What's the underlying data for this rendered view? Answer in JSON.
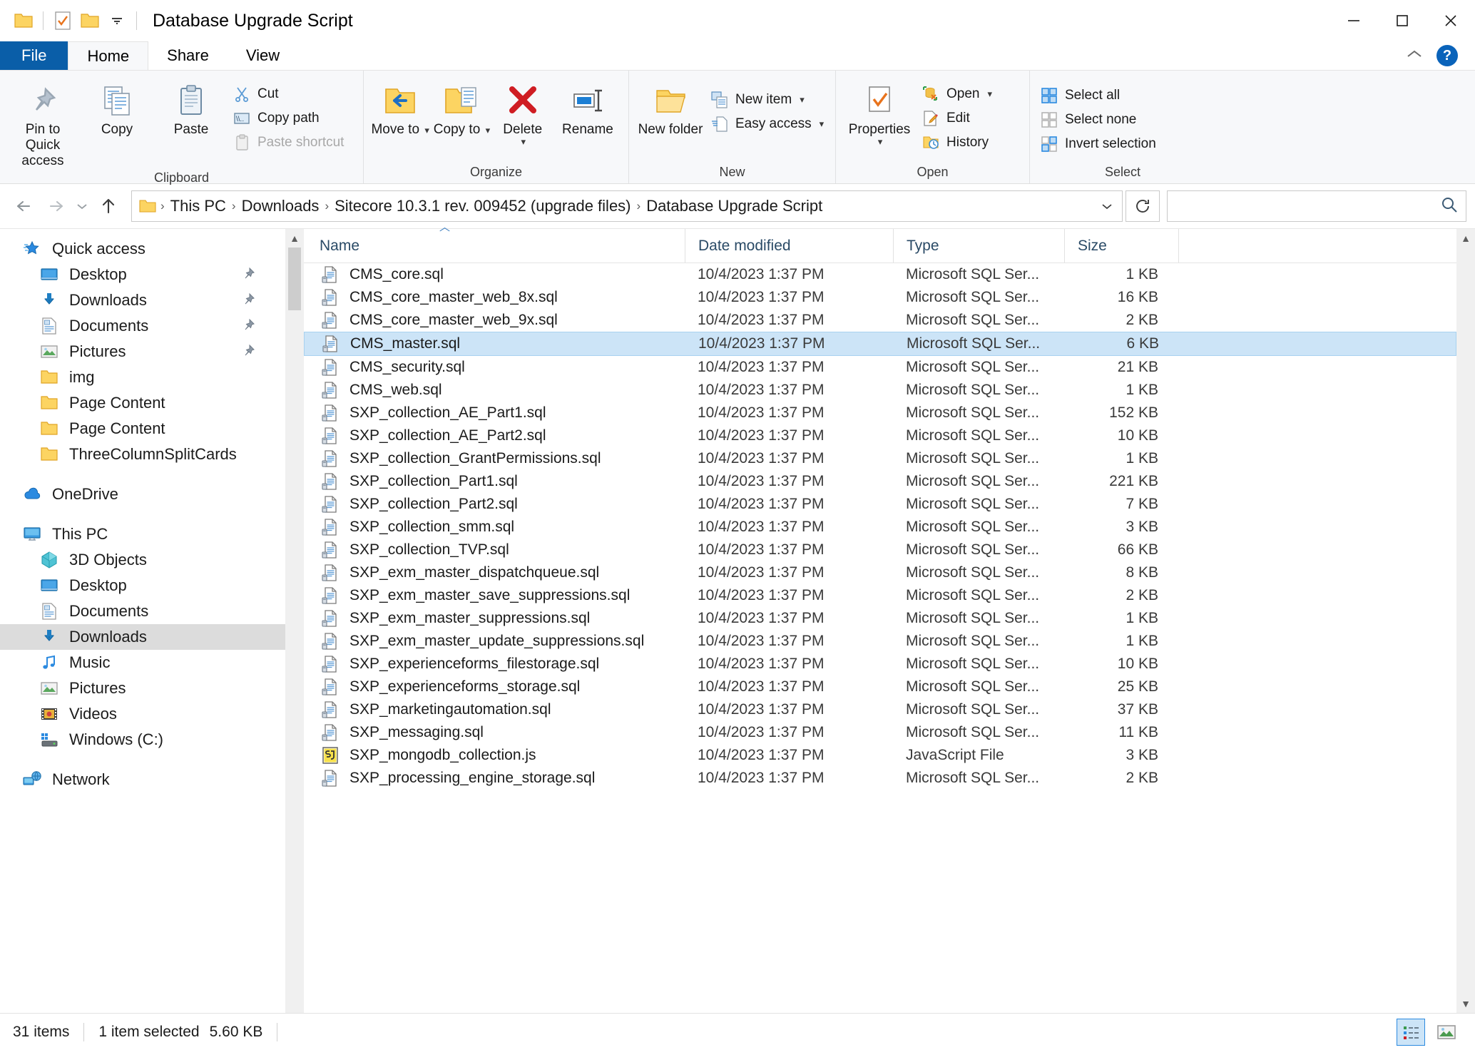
{
  "window": {
    "title": "Database Upgrade Script",
    "quick_access": [
      "folder-icon",
      "properties-icon",
      "new-folder-icon",
      "customize-dropdown-icon"
    ],
    "caption_buttons": [
      {
        "name": "minimize",
        "glyph": "—"
      },
      {
        "name": "maximize",
        "glyph": "□"
      },
      {
        "name": "close",
        "glyph": "✕"
      }
    ]
  },
  "tabs": [
    {
      "label": "File",
      "id": "file"
    },
    {
      "label": "Home",
      "id": "home"
    },
    {
      "label": "Share",
      "id": "share"
    },
    {
      "label": "View",
      "id": "view"
    }
  ],
  "tab_right": {
    "collapse_label": "⌃",
    "help_label": "?"
  },
  "ribbon": {
    "groups": [
      {
        "label": "Clipboard",
        "big": [
          {
            "label": "Pin to Quick access",
            "icon": "pin-icon"
          },
          {
            "label": "Copy",
            "icon": "copy-icon"
          },
          {
            "label": "Paste",
            "icon": "paste-icon"
          }
        ],
        "small": [
          {
            "label": "Cut",
            "icon": "scissors-icon"
          },
          {
            "label": "Copy path",
            "icon": "copy-path-icon"
          },
          {
            "label": "Paste shortcut",
            "icon": "paste-shortcut-icon",
            "disabled": true
          }
        ]
      },
      {
        "label": "Organize",
        "big": [
          {
            "label": "Move to",
            "icon": "move-to-icon",
            "dropdown": true
          },
          {
            "label": "Copy to",
            "icon": "copy-to-icon",
            "dropdown": true
          },
          {
            "label": "Delete",
            "icon": "delete-icon",
            "dropdown": true
          },
          {
            "label": "Rename",
            "icon": "rename-icon"
          }
        ],
        "small": []
      },
      {
        "label": "New",
        "big": [
          {
            "label": "New folder",
            "icon": "new-folder-icon"
          }
        ],
        "small": [
          {
            "label": "New item",
            "icon": "new-item-icon",
            "dropdown": true
          },
          {
            "label": "Easy access",
            "icon": "easy-access-icon",
            "dropdown": true
          }
        ]
      },
      {
        "label": "Open",
        "big": [
          {
            "label": "Properties",
            "icon": "properties-icon",
            "dropdown": true
          }
        ],
        "small": [
          {
            "label": "Open",
            "icon": "open-icon",
            "dropdown": true
          },
          {
            "label": "Edit",
            "icon": "edit-icon"
          },
          {
            "label": "History",
            "icon": "history-icon"
          }
        ]
      },
      {
        "label": "Select",
        "big": [],
        "small": [
          {
            "label": "Select all",
            "icon": "select-all-icon"
          },
          {
            "label": "Select none",
            "icon": "select-none-icon"
          },
          {
            "label": "Invert selection",
            "icon": "invert-selection-icon"
          }
        ]
      }
    ]
  },
  "navigation": {
    "back_icon": "arrow-left-icon",
    "forward_icon": "arrow-right-icon",
    "recent_icon": "chevron-down-icon",
    "up_icon": "arrow-up-icon",
    "refresh_icon": "refresh-icon",
    "breadcrumb": [
      "This PC",
      "Downloads",
      "Sitecore 10.3.1 rev. 009452 (upgrade files)",
      "Database Upgrade Script"
    ],
    "search_placeholder": "",
    "search_value": ""
  },
  "sidebar": {
    "items": [
      {
        "label": "Quick access",
        "icon": "quick-access-star-icon",
        "indent": 0,
        "pinned": false,
        "selected": false
      },
      {
        "label": "Desktop",
        "icon": "desktop-icon",
        "indent": 1,
        "pinned": true,
        "selected": false
      },
      {
        "label": "Downloads",
        "icon": "downloads-icon",
        "indent": 1,
        "pinned": true,
        "selected": false
      },
      {
        "label": "Documents",
        "icon": "documents-icon",
        "indent": 1,
        "pinned": true,
        "selected": false
      },
      {
        "label": "Pictures",
        "icon": "pictures-icon",
        "indent": 1,
        "pinned": true,
        "selected": false
      },
      {
        "label": "img",
        "icon": "folder-icon",
        "indent": 1,
        "pinned": false,
        "selected": false
      },
      {
        "label": "Page Content",
        "icon": "folder-icon",
        "indent": 1,
        "pinned": false,
        "selected": false
      },
      {
        "label": "Page Content",
        "icon": "folder-icon",
        "indent": 1,
        "pinned": false,
        "selected": false
      },
      {
        "label": "ThreeColumnSplitCards",
        "icon": "folder-icon",
        "indent": 1,
        "pinned": false,
        "selected": false
      },
      {
        "gap": true
      },
      {
        "label": "OneDrive",
        "icon": "onedrive-icon",
        "indent": 0,
        "pinned": false,
        "selected": false
      },
      {
        "gap": true
      },
      {
        "label": "This PC",
        "icon": "this-pc-icon",
        "indent": 0,
        "pinned": false,
        "selected": false
      },
      {
        "label": "3D Objects",
        "icon": "3d-objects-icon",
        "indent": 1,
        "pinned": false,
        "selected": false
      },
      {
        "label": "Desktop",
        "icon": "desktop-icon",
        "indent": 1,
        "pinned": false,
        "selected": false
      },
      {
        "label": "Documents",
        "icon": "documents-icon",
        "indent": 1,
        "pinned": false,
        "selected": false
      },
      {
        "label": "Downloads",
        "icon": "downloads-icon",
        "indent": 1,
        "pinned": false,
        "selected": true
      },
      {
        "label": "Music",
        "icon": "music-icon",
        "indent": 1,
        "pinned": false,
        "selected": false
      },
      {
        "label": "Pictures",
        "icon": "pictures-icon",
        "indent": 1,
        "pinned": false,
        "selected": false
      },
      {
        "label": "Videos",
        "icon": "videos-icon",
        "indent": 1,
        "pinned": false,
        "selected": false
      },
      {
        "label": "Windows (C:)",
        "icon": "drive-icon",
        "indent": 1,
        "pinned": false,
        "selected": false
      },
      {
        "gap": true
      },
      {
        "label": "Network",
        "icon": "network-icon",
        "indent": 0,
        "pinned": false,
        "selected": false
      }
    ]
  },
  "filelist": {
    "columns": [
      {
        "label": "Name",
        "key": "name",
        "sorted": "asc"
      },
      {
        "label": "Date modified",
        "key": "date"
      },
      {
        "label": "Type",
        "key": "type"
      },
      {
        "label": "Size",
        "key": "size"
      }
    ],
    "rows": [
      {
        "name": "CMS_core.sql",
        "date": "10/4/2023 1:37 PM",
        "type": "Microsoft SQL Ser...",
        "size": "1 KB",
        "icon": "sql-file-icon",
        "selected": false
      },
      {
        "name": "CMS_core_master_web_8x.sql",
        "date": "10/4/2023 1:37 PM",
        "type": "Microsoft SQL Ser...",
        "size": "16 KB",
        "icon": "sql-file-icon",
        "selected": false
      },
      {
        "name": "CMS_core_master_web_9x.sql",
        "date": "10/4/2023 1:37 PM",
        "type": "Microsoft SQL Ser...",
        "size": "2 KB",
        "icon": "sql-file-icon",
        "selected": false
      },
      {
        "name": "CMS_master.sql",
        "date": "10/4/2023 1:37 PM",
        "type": "Microsoft SQL Ser...",
        "size": "6 KB",
        "icon": "sql-file-icon",
        "selected": true
      },
      {
        "name": "CMS_security.sql",
        "date": "10/4/2023 1:37 PM",
        "type": "Microsoft SQL Ser...",
        "size": "21 KB",
        "icon": "sql-file-icon",
        "selected": false
      },
      {
        "name": "CMS_web.sql",
        "date": "10/4/2023 1:37 PM",
        "type": "Microsoft SQL Ser...",
        "size": "1 KB",
        "icon": "sql-file-icon",
        "selected": false
      },
      {
        "name": "SXP_collection_AE_Part1.sql",
        "date": "10/4/2023 1:37 PM",
        "type": "Microsoft SQL Ser...",
        "size": "152 KB",
        "icon": "sql-file-icon",
        "selected": false
      },
      {
        "name": "SXP_collection_AE_Part2.sql",
        "date": "10/4/2023 1:37 PM",
        "type": "Microsoft SQL Ser...",
        "size": "10 KB",
        "icon": "sql-file-icon",
        "selected": false
      },
      {
        "name": "SXP_collection_GrantPermissions.sql",
        "date": "10/4/2023 1:37 PM",
        "type": "Microsoft SQL Ser...",
        "size": "1 KB",
        "icon": "sql-file-icon",
        "selected": false
      },
      {
        "name": "SXP_collection_Part1.sql",
        "date": "10/4/2023 1:37 PM",
        "type": "Microsoft SQL Ser...",
        "size": "221 KB",
        "icon": "sql-file-icon",
        "selected": false
      },
      {
        "name": "SXP_collection_Part2.sql",
        "date": "10/4/2023 1:37 PM",
        "type": "Microsoft SQL Ser...",
        "size": "7 KB",
        "icon": "sql-file-icon",
        "selected": false
      },
      {
        "name": "SXP_collection_smm.sql",
        "date": "10/4/2023 1:37 PM",
        "type": "Microsoft SQL Ser...",
        "size": "3 KB",
        "icon": "sql-file-icon",
        "selected": false
      },
      {
        "name": "SXP_collection_TVP.sql",
        "date": "10/4/2023 1:37 PM",
        "type": "Microsoft SQL Ser...",
        "size": "66 KB",
        "icon": "sql-file-icon",
        "selected": false
      },
      {
        "name": "SXP_exm_master_dispatchqueue.sql",
        "date": "10/4/2023 1:37 PM",
        "type": "Microsoft SQL Ser...",
        "size": "8 KB",
        "icon": "sql-file-icon",
        "selected": false
      },
      {
        "name": "SXP_exm_master_save_suppressions.sql",
        "date": "10/4/2023 1:37 PM",
        "type": "Microsoft SQL Ser...",
        "size": "2 KB",
        "icon": "sql-file-icon",
        "selected": false
      },
      {
        "name": "SXP_exm_master_suppressions.sql",
        "date": "10/4/2023 1:37 PM",
        "type": "Microsoft SQL Ser...",
        "size": "1 KB",
        "icon": "sql-file-icon",
        "selected": false
      },
      {
        "name": "SXP_exm_master_update_suppressions.sql",
        "date": "10/4/2023 1:37 PM",
        "type": "Microsoft SQL Ser...",
        "size": "1 KB",
        "icon": "sql-file-icon",
        "selected": false
      },
      {
        "name": "SXP_experienceforms_filestorage.sql",
        "date": "10/4/2023 1:37 PM",
        "type": "Microsoft SQL Ser...",
        "size": "10 KB",
        "icon": "sql-file-icon",
        "selected": false
      },
      {
        "name": "SXP_experienceforms_storage.sql",
        "date": "10/4/2023 1:37 PM",
        "type": "Microsoft SQL Ser...",
        "size": "25 KB",
        "icon": "sql-file-icon",
        "selected": false
      },
      {
        "name": "SXP_marketingautomation.sql",
        "date": "10/4/2023 1:37 PM",
        "type": "Microsoft SQL Ser...",
        "size": "37 KB",
        "icon": "sql-file-icon",
        "selected": false
      },
      {
        "name": "SXP_messaging.sql",
        "date": "10/4/2023 1:37 PM",
        "type": "Microsoft SQL Ser...",
        "size": "11 KB",
        "icon": "sql-file-icon",
        "selected": false
      },
      {
        "name": "SXP_mongodb_collection.js",
        "date": "10/4/2023 1:37 PM",
        "type": "JavaScript File",
        "size": "3 KB",
        "icon": "js-file-icon",
        "selected": false
      },
      {
        "name": "SXP_processing_engine_storage.sql",
        "date": "10/4/2023 1:37 PM",
        "type": "Microsoft SQL Ser...",
        "size": "2 KB",
        "icon": "sql-file-icon",
        "selected": false
      }
    ]
  },
  "statusbar": {
    "item_count": "31 items",
    "selection": "1 item selected",
    "selection_size": "5.60 KB",
    "views": [
      {
        "name": "details-view",
        "active": true
      },
      {
        "name": "large-icons-view",
        "active": false
      }
    ]
  }
}
